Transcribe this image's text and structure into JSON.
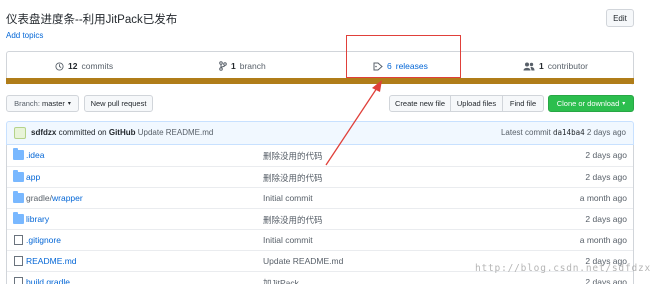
{
  "repo": {
    "title": "仪表盘进度条--利用JitPack已发布",
    "add_topics": "Add topics",
    "edit_label": "Edit"
  },
  "summary": {
    "commits_count": "12",
    "commits_label": "commits",
    "branch_count": "1",
    "branch_label": "branch",
    "releases_count": "6",
    "releases_label": "releases",
    "contributor_count": "1",
    "contributor_label": "contributor",
    "language_bar_color": "#b07d19"
  },
  "toolbar": {
    "branch_prefix": "Branch:",
    "branch_value": "master",
    "new_pr": "New pull request",
    "create_file": "Create new file",
    "upload": "Upload files",
    "find": "Find file",
    "clone": "Clone or download"
  },
  "latest_commit": {
    "user": "sdfdzx",
    "committed_on": "committed on",
    "platform": "GitHub",
    "message": "Update README.md",
    "latest_label": "Latest commit",
    "sha": "da14ba4",
    "age": "2 days ago"
  },
  "files": [
    {
      "type": "folder",
      "name": ".idea",
      "name_dim": "",
      "message": "删除没用的代码",
      "age": "2 days ago"
    },
    {
      "type": "folder",
      "name": "app",
      "name_dim": "",
      "message": "删除没用的代码",
      "age": "2 days ago"
    },
    {
      "type": "folder",
      "name": "wrapper",
      "name_dim": "gradle/",
      "message": "Initial commit",
      "age": "a month ago"
    },
    {
      "type": "folder",
      "name": "library",
      "name_dim": "",
      "message": "删除没用的代码",
      "age": "2 days ago"
    },
    {
      "type": "file",
      "name": ".gitignore",
      "name_dim": "",
      "message": "Initial commit",
      "age": "a month ago"
    },
    {
      "type": "file",
      "name": "README.md",
      "name_dim": "",
      "message": "Update README.md",
      "age": "2 days ago"
    },
    {
      "type": "file",
      "name": "build.gradle",
      "name_dim": "",
      "message": "加JitPack",
      "age": "2 days ago"
    }
  ],
  "watermark": "http://blog.csdn.net/sdfdzx",
  "annotation_color": "#e0403a"
}
